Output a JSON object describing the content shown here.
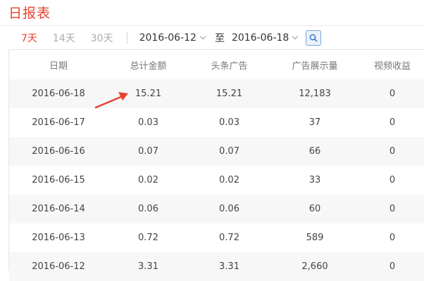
{
  "title": "日报表",
  "toolbar": {
    "range_tabs": [
      "7天",
      "14天",
      "30天"
    ],
    "active_tab": "7天",
    "start_date": "2016-06-12",
    "to_label": "至",
    "end_date": "2016-06-18",
    "search_icon": "search-icon"
  },
  "table": {
    "headers": [
      "日期",
      "总计金额",
      "头条广告",
      "广告展示量",
      "视频收益"
    ],
    "rows": [
      [
        "2016-06-18",
        "15.21",
        "15.21",
        "12,183",
        "0"
      ],
      [
        "2016-06-17",
        "0.03",
        "0.03",
        "37",
        "0"
      ],
      [
        "2016-06-16",
        "0.07",
        "0.07",
        "66",
        "0"
      ],
      [
        "2016-06-15",
        "0.02",
        "0.02",
        "33",
        "0"
      ],
      [
        "2016-06-14",
        "0.06",
        "0.06",
        "60",
        "0"
      ],
      [
        "2016-06-13",
        "0.72",
        "0.72",
        "589",
        "0"
      ],
      [
        "2016-06-12",
        "3.31",
        "3.31",
        "2,660",
        "0"
      ]
    ]
  },
  "colors": {
    "accent": "#e8412f",
    "alt_row": "#f7f7f7",
    "header_text": "#777777"
  },
  "annotation": {
    "icon": "red-arrow-icon"
  }
}
